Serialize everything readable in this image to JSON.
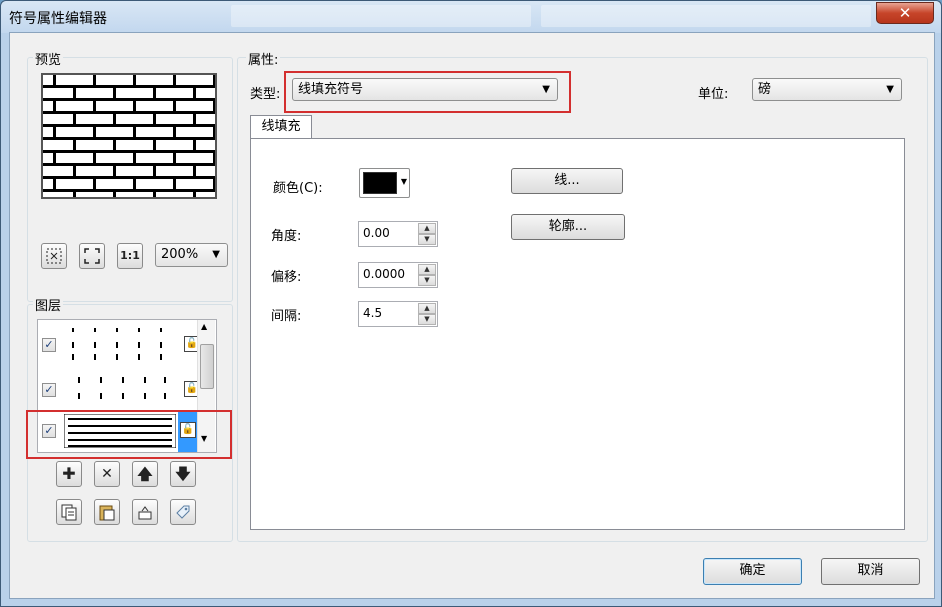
{
  "window": {
    "title": "符号属性编辑器",
    "close_glyph": "✕"
  },
  "preview": {
    "label": "预览",
    "zoom_value": "200%",
    "fit_label": "1:1"
  },
  "layers": {
    "label": "图层",
    "items": [
      {
        "checked": true,
        "pattern": "dots-sparse"
      },
      {
        "checked": true,
        "pattern": "dots-offset"
      },
      {
        "checked": true,
        "pattern": "lines",
        "selected": true
      }
    ],
    "check_glyph": "✓",
    "lock_glyph": "🔓"
  },
  "toolbar": {
    "add_glyph": "✚",
    "remove_glyph": "✕",
    "up_glyph": "🡅",
    "down_glyph": "🡇"
  },
  "properties": {
    "label": "属性:",
    "type_label": "类型:",
    "type_value": "线填充符号",
    "unit_label": "单位:",
    "unit_value": "磅",
    "tab_label": "线填充",
    "color_label": "颜色(C):",
    "color_value": "#000000",
    "line_button": "线...",
    "outline_button": "轮廓...",
    "angle_label": "角度:",
    "angle_value": "0.00",
    "offset_label": "偏移:",
    "offset_value": "0.0000",
    "spacing_label": "间隔:",
    "spacing_value": "4.5"
  },
  "footer": {
    "ok_label": "确定",
    "cancel_label": "取消"
  },
  "colors": {
    "highlight_red": "#d32f2f",
    "selection_blue": "#3399ff"
  }
}
